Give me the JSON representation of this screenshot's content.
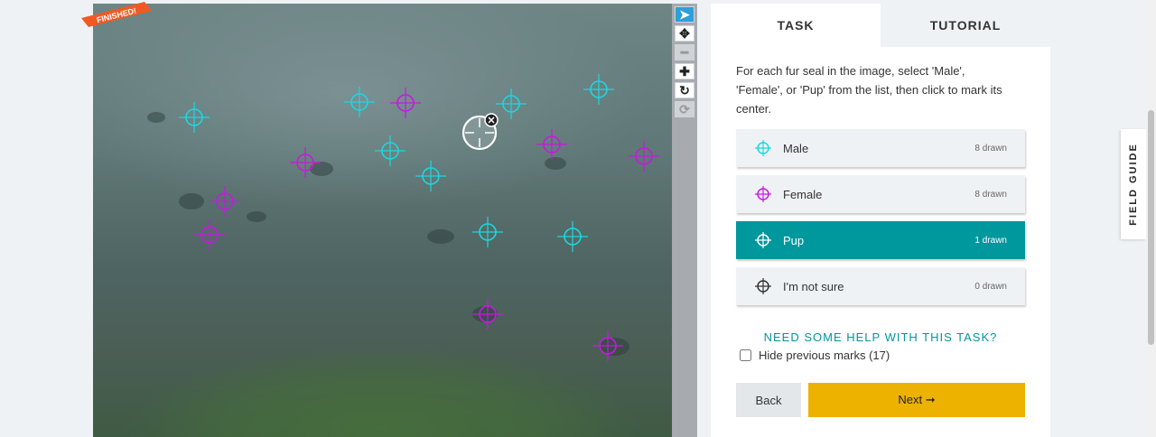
{
  "badge": {
    "label": "FINISHED!"
  },
  "colors": {
    "male": "#1ad8e0",
    "female": "#c51ae0",
    "pup": "#00979d",
    "unsure": "#333333",
    "next": "#edb100"
  },
  "toolbar": [
    {
      "name": "pointer-tool",
      "glyph": "➤",
      "state": "active"
    },
    {
      "name": "move-tool",
      "glyph": "✥",
      "state": "normal"
    },
    {
      "name": "zoom-out-tool",
      "glyph": "━",
      "state": "disabled"
    },
    {
      "name": "zoom-in-tool",
      "glyph": "✚",
      "state": "normal"
    },
    {
      "name": "rotate-tool",
      "glyph": "↻",
      "state": "normal"
    },
    {
      "name": "reset-tool",
      "glyph": "⟳",
      "state": "disabled"
    }
  ],
  "tabs": {
    "task": "TASK",
    "tutorial": "TUTORIAL"
  },
  "instructions": "For each fur seal in the image, select 'Male', 'Female', or 'Pup' from the list, then click to mark its center.",
  "options": [
    {
      "label": "Male",
      "count": "8 drawn",
      "icon": "crosshair-cyan-icon"
    },
    {
      "label": "Female",
      "count": "8 drawn",
      "icon": "crosshair-magenta-icon"
    },
    {
      "label": "Pup",
      "count": "1 drawn",
      "icon": "crosshair-white-icon"
    },
    {
      "label": "I'm not sure",
      "count": "0 drawn",
      "icon": "crosshair-dark-icon"
    }
  ],
  "help": "NEED SOME HELP WITH THIS TASK?",
  "hide_marks": "Hide previous marks (17)",
  "buttons": {
    "back": "Back",
    "next": "Next ➞"
  },
  "field_guide": "FIELD GUIDE"
}
